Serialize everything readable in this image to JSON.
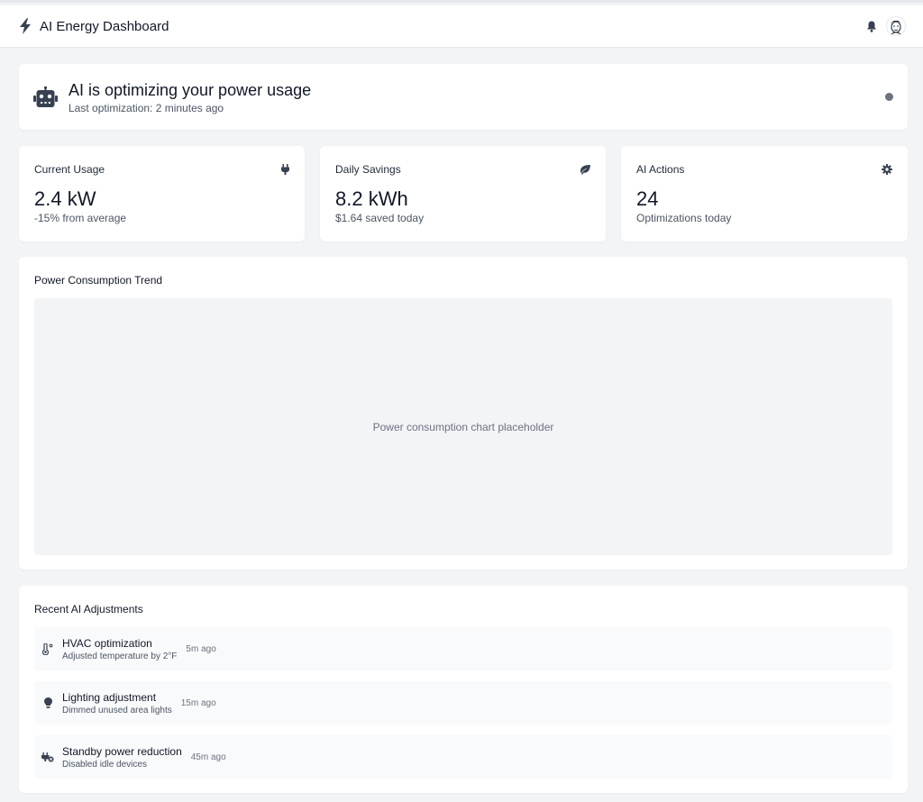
{
  "header": {
    "title": "AI Energy Dashboard",
    "logo_icon": "bolt-icon",
    "notification_icon": "bell-icon",
    "avatar_icon": "user-avatar"
  },
  "status": {
    "icon": "robot-icon",
    "title": "AI is optimizing your power usage",
    "subtitle": "Last optimization: 2 minutes ago",
    "indicator_color": "#6b7280"
  },
  "stats": [
    {
      "label": "Current Usage",
      "value": "2.4 kW",
      "sub": "-15% from average",
      "icon": "plug-icon"
    },
    {
      "label": "Daily Savings",
      "value": "8.2 kWh",
      "sub": "$1.64 saved today",
      "icon": "leaf-icon"
    },
    {
      "label": "AI Actions",
      "value": "24",
      "sub": "Optimizations today",
      "icon": "gear-icon"
    }
  ],
  "trend": {
    "title": "Power Consumption Trend",
    "placeholder": "Power consumption chart placeholder"
  },
  "recent": {
    "title": "Recent AI Adjustments",
    "items": [
      {
        "icon": "thermometer-icon",
        "title": "HVAC optimization",
        "desc": "Adjusted temperature by 2°F",
        "time": "5m ago"
      },
      {
        "icon": "lightbulb-icon",
        "title": "Lighting adjustment",
        "desc": "Dimmed unused area lights",
        "time": "15m ago"
      },
      {
        "icon": "plug-off-icon",
        "title": "Standby power reduction",
        "desc": "Disabled idle devices",
        "time": "45m ago"
      }
    ]
  },
  "colors": {
    "background": "#f3f4f6",
    "card": "#ffffff",
    "text": "#111827",
    "muted": "#4b5563",
    "icon": "#374151"
  }
}
